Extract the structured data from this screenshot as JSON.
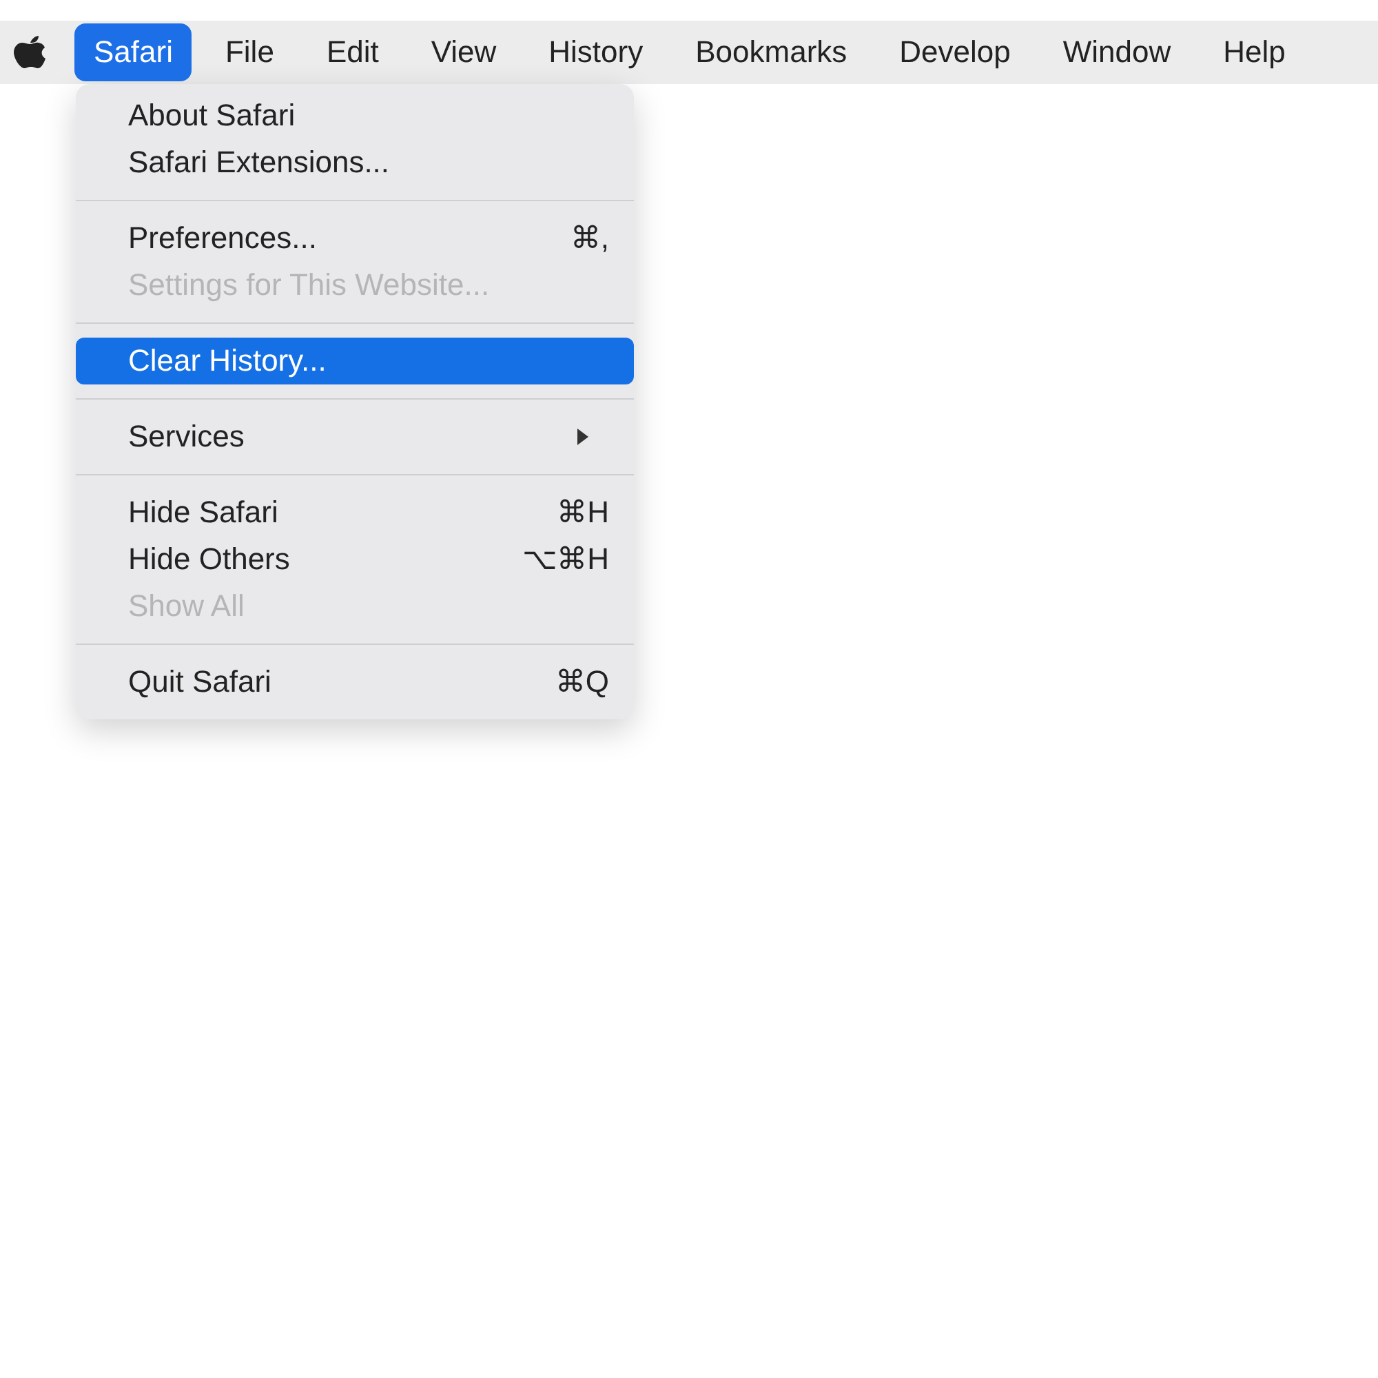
{
  "menu_bar": [
    {
      "label": "Safari",
      "selected": true
    },
    {
      "label": "File",
      "selected": false
    },
    {
      "label": "Edit",
      "selected": false
    },
    {
      "label": "View",
      "selected": false
    },
    {
      "label": "History",
      "selected": false
    },
    {
      "label": "Bookmarks",
      "selected": false
    },
    {
      "label": "Develop",
      "selected": false
    },
    {
      "label": "Window",
      "selected": false
    },
    {
      "label": "Help",
      "selected": false
    }
  ],
  "menu": {
    "items": [
      {
        "kind": "item",
        "label": "About Safari",
        "disabled": false,
        "selected": false
      },
      {
        "kind": "item",
        "label": "Safari Extensions...",
        "disabled": false,
        "selected": false
      },
      {
        "kind": "separator"
      },
      {
        "kind": "item",
        "label": "Preferences...",
        "shortcut": "⌘,",
        "disabled": false,
        "selected": false
      },
      {
        "kind": "item",
        "label": "Settings for This Website...",
        "disabled": true,
        "selected": false
      },
      {
        "kind": "separator"
      },
      {
        "kind": "item",
        "label": "Clear History...",
        "disabled": false,
        "selected": true
      },
      {
        "kind": "separator"
      },
      {
        "kind": "submenu",
        "label": "Services",
        "disabled": false,
        "selected": false
      },
      {
        "kind": "separator"
      },
      {
        "kind": "item",
        "label": "Hide Safari",
        "shortcut": "⌘H",
        "disabled": false,
        "selected": false
      },
      {
        "kind": "item",
        "label": "Hide Others",
        "shortcut": "⌥⌘H",
        "disabled": false,
        "selected": false
      },
      {
        "kind": "item",
        "label": "Show All",
        "disabled": true,
        "selected": false
      },
      {
        "kind": "separator"
      },
      {
        "kind": "item",
        "label": "Quit Safari",
        "shortcut": "⌘Q",
        "disabled": false,
        "selected": false
      }
    ]
  }
}
